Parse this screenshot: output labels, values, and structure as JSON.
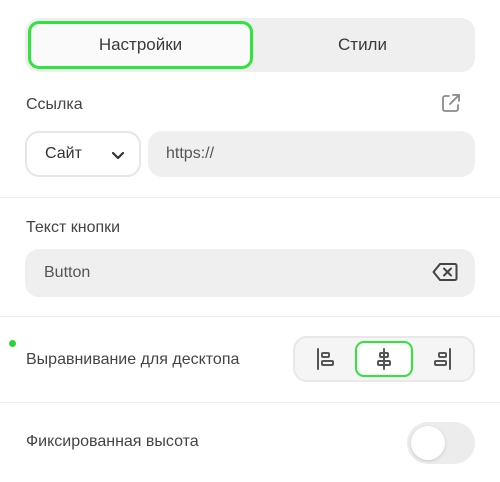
{
  "tabs": [
    {
      "label": "Настройки",
      "active": true
    },
    {
      "label": "Стили",
      "active": false
    }
  ],
  "link": {
    "label": "Ссылка",
    "open_icon": "external-link-icon",
    "type_select": {
      "value": "Сайт",
      "icon": "chevron-down-icon"
    },
    "url_value": "https://"
  },
  "button_text": {
    "label": "Текст кнопки",
    "value": "Button",
    "clear_icon": "backspace-clear-icon"
  },
  "desktop_align": {
    "label": "Выравнивание для десктопа",
    "options": [
      "align-left-icon",
      "align-center-icon",
      "align-right-icon"
    ],
    "selected": "align-center-icon"
  },
  "fixed_height": {
    "label": "Фиксированная высота",
    "enabled": false
  },
  "colors": {
    "accent": "#2fe43a",
    "field_bg": "#efefef"
  }
}
